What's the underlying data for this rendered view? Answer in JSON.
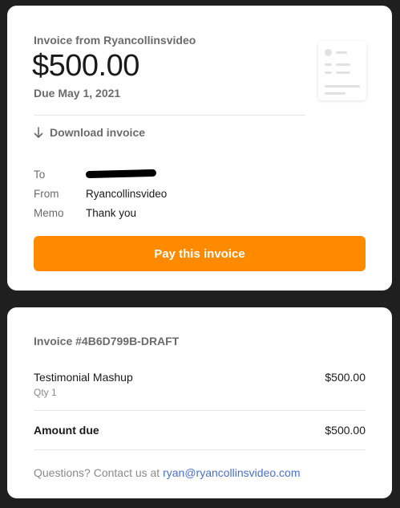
{
  "invoice_card": {
    "from_label": "Invoice from Ryancollinsvideo",
    "amount": "$500.00",
    "due_date": "Due May 1, 2021",
    "download_label": "Download invoice",
    "details": {
      "to_label": "To",
      "to_value_redacted": true,
      "from_label": "From",
      "from_value": "Ryancollinsvideo",
      "memo_label": "Memo",
      "memo_value": "Thank you"
    },
    "pay_button_label": "Pay this invoice",
    "pay_button_color": "#ff8a00"
  },
  "summary_card": {
    "invoice_number": "Invoice #4B6D799B-DRAFT",
    "line_item": {
      "name": "Testimonial Mashup",
      "qty": "Qty 1",
      "amount": "$500.00"
    },
    "amount_due_label": "Amount due",
    "amount_due_value": "$500.00",
    "contact_prefix": "Questions? Contact us at",
    "contact_email": "ryan@ryancollinsvideo.com",
    "link_color": "#4a6fd1"
  },
  "icons": [
    "download-arrow-icon",
    "invoice-document-icon"
  ]
}
